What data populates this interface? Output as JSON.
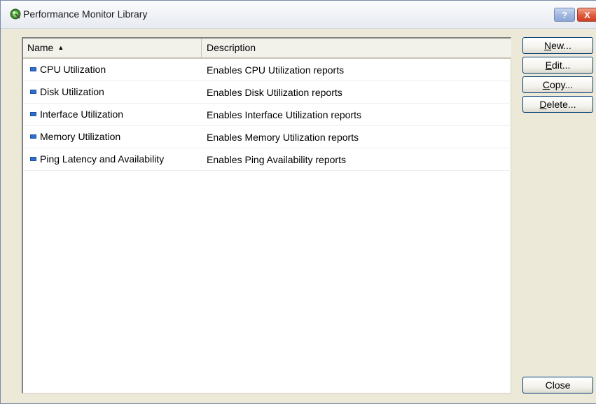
{
  "window": {
    "title": "Performance Monitor Library",
    "help_label": "?",
    "close_label": "X"
  },
  "list": {
    "columns": [
      {
        "label": "Name",
        "sort": "ascending"
      },
      {
        "label": "Description"
      }
    ],
    "rows": [
      {
        "name": "CPU Utilization",
        "description": "Enables CPU Utilization reports"
      },
      {
        "name": "Disk Utilization",
        "description": "Enables Disk Utilization reports"
      },
      {
        "name": "Interface Utilization",
        "description": "Enables Interface Utilization reports"
      },
      {
        "name": "Memory Utilization",
        "description": "Enables Memory Utilization reports"
      },
      {
        "name": "Ping Latency and Availability",
        "description": "Enables Ping Availability reports"
      }
    ]
  },
  "buttons": {
    "new": "New...",
    "edit": "Edit...",
    "copy": "Copy...",
    "delete": "Delete...",
    "close": "Close"
  },
  "colors": {
    "row_icon": "#2f6fd0",
    "window_bg": "#ece9d8",
    "close_button": "#e0583b"
  },
  "icons": {
    "app": "performance-monitor-icon",
    "row": "monitor-item-icon",
    "sort": "sort-ascending-icon"
  }
}
